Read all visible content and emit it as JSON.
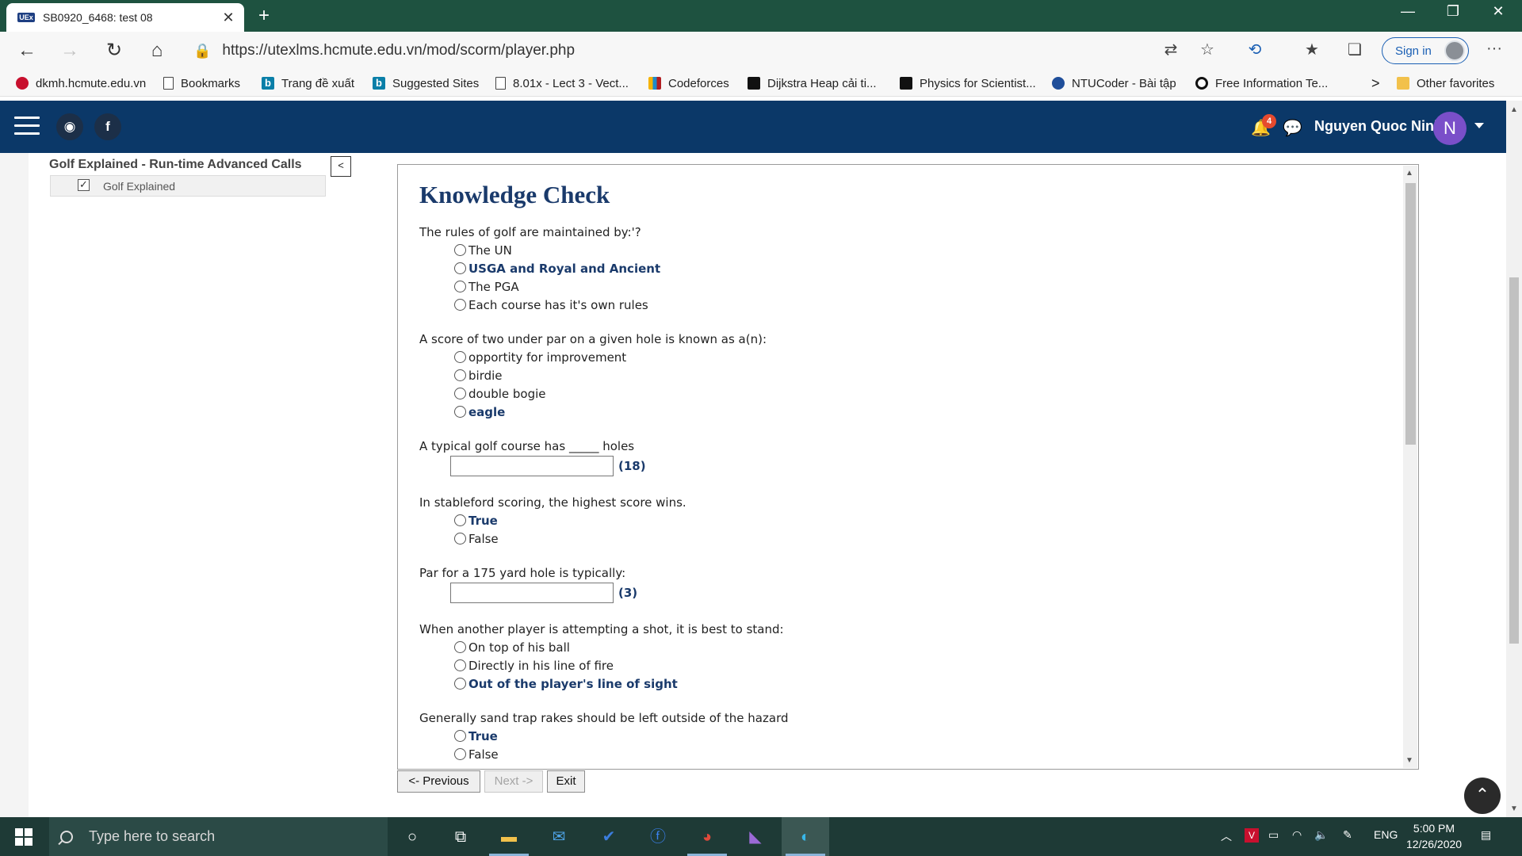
{
  "browser": {
    "tab_title": "SB0920_6468: test 08",
    "tab_favicon": "UEx",
    "tab_close": "✕",
    "new_tab": "+",
    "url": "https://utexlms.hcmute.edu.vn/mod/scorm/player.php",
    "sign_in": "Sign in",
    "minimize": "—",
    "restore": "❐",
    "close": "✕"
  },
  "favorites": [
    {
      "label": "dkmh.hcmute.edu.vn",
      "icon": "red"
    },
    {
      "label": "Bookmarks",
      "icon": "page"
    },
    {
      "label": "Trang đề xuất",
      "icon": "bing"
    },
    {
      "label": "Suggested Sites",
      "icon": "bing"
    },
    {
      "label": "8.01x - Lect 3 - Vect...",
      "icon": "page"
    },
    {
      "label": "Codeforces",
      "icon": "cf"
    },
    {
      "label": "Dijkstra Heap cải ti...",
      "icon": "dark"
    },
    {
      "label": "Physics for Scientist...",
      "icon": "dark"
    },
    {
      "label": "NTUCoder - Bài tập",
      "icon": "blue"
    },
    {
      "label": "Free Information Te...",
      "icon": "ring"
    }
  ],
  "favorites_more": ">",
  "other_favorites": "Other favorites",
  "header": {
    "notification_count": "4",
    "user_name": "Nguyen Quoc Ninh",
    "user_initial": "N"
  },
  "toc": {
    "title": "Golf Explained - Run-time Advanced Calls",
    "item": "Golf Explained",
    "toggle": "<"
  },
  "quiz": {
    "title": "Knowledge Check",
    "q1": {
      "text": "The rules of golf are maintained by:'?",
      "options": [
        "The UN",
        "USGA and Royal and Ancient",
        "The PGA",
        "Each course has it's own rules"
      ]
    },
    "q2": {
      "text": "A score of two under par on a given hole is known as a(n):",
      "options": [
        "opportity for improvement",
        "birdie",
        "double bogie",
        "eagle"
      ]
    },
    "q3": {
      "text": "A typical golf course has _____ holes",
      "answer": "(18)"
    },
    "q4": {
      "text": "In stableford scoring, the highest score wins.",
      "options": [
        "True",
        "False"
      ]
    },
    "q5": {
      "text": "Par for a 175 yard hole is typically:",
      "answer": "(3)"
    },
    "q6": {
      "text": "When another player is attempting a shot, it is best to stand:",
      "options": [
        "On top of his ball",
        "Directly in his line of fire",
        "Out of the player's line of sight"
      ]
    },
    "q7": {
      "text": "Generally sand trap rakes should be left outside of the hazard",
      "options": [
        "True",
        "False"
      ]
    }
  },
  "nav": {
    "previous": "<- Previous",
    "next": "Next ->",
    "exit": "Exit"
  },
  "taskbar": {
    "search_placeholder": "Type here to search",
    "language": "ENG",
    "time": "5:00 PM",
    "date": "12/26/2020"
  }
}
